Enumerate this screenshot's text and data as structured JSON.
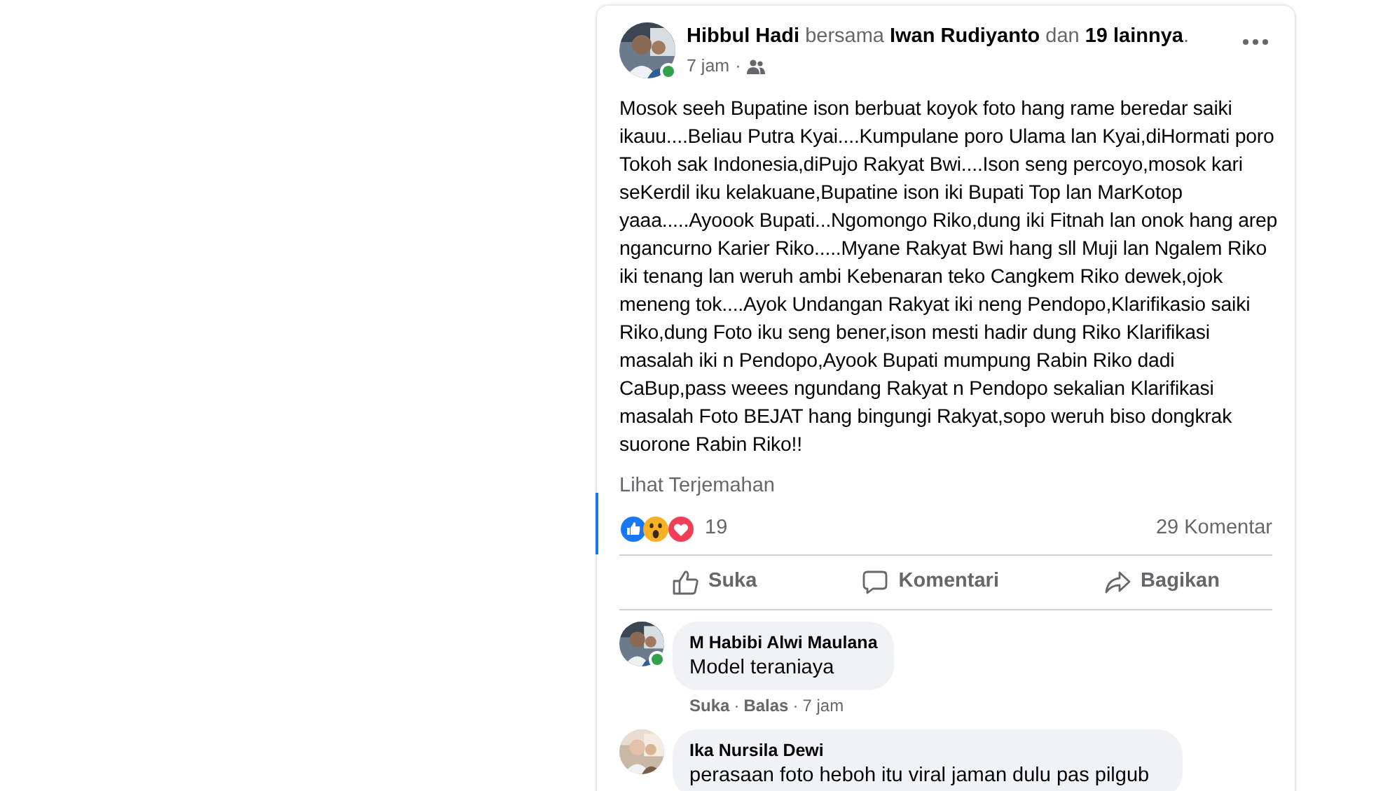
{
  "post": {
    "author": "Hibbul Hadi",
    "with_word": "bersama",
    "tagged": "Iwan Rudiyanto",
    "and_word": "dan",
    "others": "19 lainnya",
    "end_mark": ".",
    "time": "7 jam",
    "separator": "·",
    "online": true,
    "text": "Mosok seeh Bupatine ison berbuat koyok foto hang rame beredar saiki ikauu....Beliau Putra Kyai....Kumpulane poro Ulama lan Kyai,diHormati poro Tokoh sak Indonesia,diPujo Rakyat Bwi....Ison seng percoyo,mosok kari seKerdil iku kelakuane,Bupatine ison iki Bupati Top lan MarKotop yaaa.....Ayoook Bupati...Ngomongo Riko,dung iki Fitnah lan onok hang arep ngancurno Karier Riko.....Myane Rakyat Bwi hang sll Muji lan Ngalem Riko iki tenang lan weruh ambi Kebenaran teko Cangkem Riko dewek,ojok meneng tok....Ayok Undangan Rakyat iki neng Pendopo,Klarifikasio saiki Riko,dung Foto iku seng bener,ison mesti hadir dung Riko Klarifikasi masalah iki n Pendopo,Ayook Bupati mumpung Rabin Riko dadi CaBup,pass weees ngundang Rakyat n Pendopo sekalian Klarifikasi masalah Foto BEJAT hang bingungi Rakyat,sopo weruh biso dongkrak suorone Rabin Riko!!",
    "translate": "Lihat Terjemahan",
    "reaction_count": "19",
    "comment_count": "29 Komentar",
    "actions": [
      {
        "kind": "like",
        "label": "Suka"
      },
      {
        "kind": "comment",
        "label": "Komentari"
      },
      {
        "kind": "share",
        "label": "Bagikan"
      }
    ]
  },
  "comments": [
    {
      "name": "M Habibi Alwi Maulana",
      "text": "Model teraniaya",
      "online": true,
      "separator": "·",
      "actions": [
        "Suka",
        "Balas",
        "7 jam"
      ]
    },
    {
      "name": "Ika Nursila Dewi",
      "text": "perasaan foto heboh itu viral jaman dulu pas pilgub",
      "online": false
    }
  ]
}
